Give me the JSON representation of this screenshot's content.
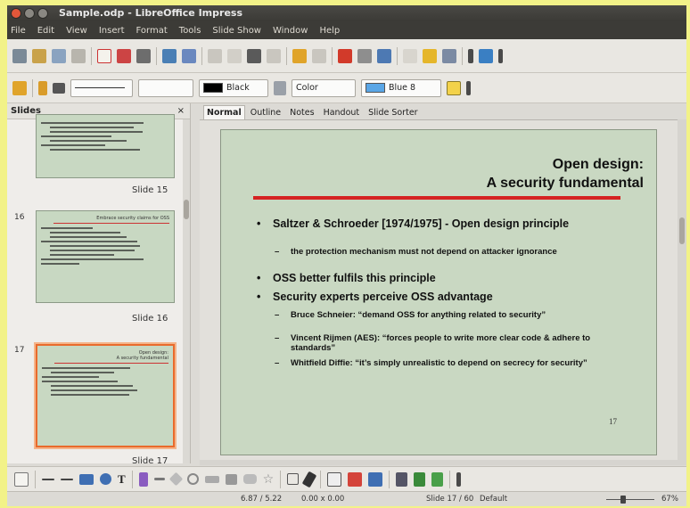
{
  "window": {
    "title": "Sample.odp - LibreOffice Impress"
  },
  "menu": [
    "File",
    "Edit",
    "View",
    "Insert",
    "Format",
    "Tools",
    "Slide Show",
    "Window",
    "Help"
  ],
  "format_toolbar": {
    "line_style_value": "",
    "line_width_value": "",
    "line_color": "Black",
    "area_style": "Color",
    "fill_color": "Blue 8",
    "line_color_hex": "#000000",
    "fill_color_hex": "#5aa6e6"
  },
  "slides_pane": {
    "title": "Slides",
    "close": "×",
    "thumbnails": [
      {
        "number": "",
        "label": "Slide 15"
      },
      {
        "number": "16",
        "label": "Slide 16",
        "title": "Embrace security claims for OSS"
      },
      {
        "number": "17",
        "label": "Slide 17",
        "title": "Open design:\nA security fundamental",
        "selected": true
      }
    ]
  },
  "view_tabs": [
    "Normal",
    "Outline",
    "Notes",
    "Handout",
    "Slide Sorter"
  ],
  "active_tab": "Normal",
  "slide": {
    "title_line1": "Open design:",
    "title_line2": "A security fundamental",
    "bullets": [
      {
        "level": 1,
        "text": "Saltzer & Schroeder [1974/1975] - Open design principle"
      },
      {
        "level": 2,
        "text": "the protection mechanism must not depend on attacker ignorance"
      },
      {
        "level": 1,
        "text": "OSS better fulfils this principle"
      },
      {
        "level": 1,
        "text": "Security experts perceive OSS advantage"
      },
      {
        "level": 2,
        "text": "Bruce Schneier: “demand OSS for anything related to security”"
      },
      {
        "level": 2,
        "text": "Vincent Rijmen (AES): “forces people to write more clear code & adhere to standards”"
      },
      {
        "level": 2,
        "text": "Whitfield Diffie: “it’s simply unrealistic to depend on secrecy for security”"
      }
    ],
    "page_number": "17"
  },
  "status": {
    "position": "6.87 / 5.22",
    "size": "0.00 x 0.00",
    "slide": "Slide 17 / 60",
    "master": "Default",
    "zoom": "67%"
  }
}
